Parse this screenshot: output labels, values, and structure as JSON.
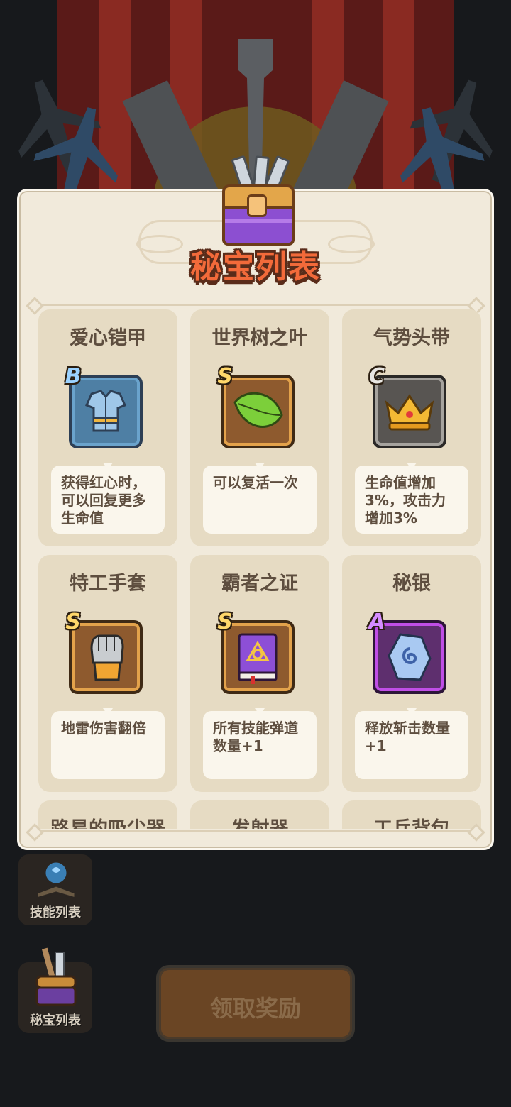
{
  "panel": {
    "title": "秘宝列表",
    "items": [
      {
        "name": "爱心铠甲",
        "rank": "B",
        "icon": "armor-icon",
        "frame": "blue",
        "desc": "获得红心时，\n可以回复更多\n生命值"
      },
      {
        "name": "世界树之叶",
        "rank": "S",
        "icon": "leaf-icon",
        "frame": "orange",
        "desc": "可以复活一次"
      },
      {
        "name": "气势头带",
        "rank": "C",
        "icon": "crown-icon",
        "frame": "gray",
        "desc": "生命值增加\n3%，攻击力\n增加3%"
      },
      {
        "name": "特工手套",
        "rank": "S",
        "icon": "gauntlet-icon",
        "frame": "orange",
        "desc": "地雷伤害翻倍"
      },
      {
        "name": "霸者之证",
        "rank": "S",
        "icon": "book-icon",
        "frame": "orange",
        "desc": "所有技能弹道\n数量+1"
      },
      {
        "name": "秘银",
        "rank": "A",
        "icon": "rune-stone-icon",
        "frame": "purple",
        "desc": "释放斩击数量\n+1"
      },
      {
        "name": "路易的吸尘器"
      },
      {
        "name": "发射器"
      },
      {
        "name": "工兵背包"
      }
    ]
  },
  "side_buttons": {
    "skills": "技能列表",
    "treasures": "秘宝列表"
  },
  "claim_button": "领取奖励",
  "colors": {
    "title": "#f26a3a",
    "panel_bg": "#f1eadb",
    "card_bg": "#e6dbc3",
    "text": "#5e4e3f"
  }
}
